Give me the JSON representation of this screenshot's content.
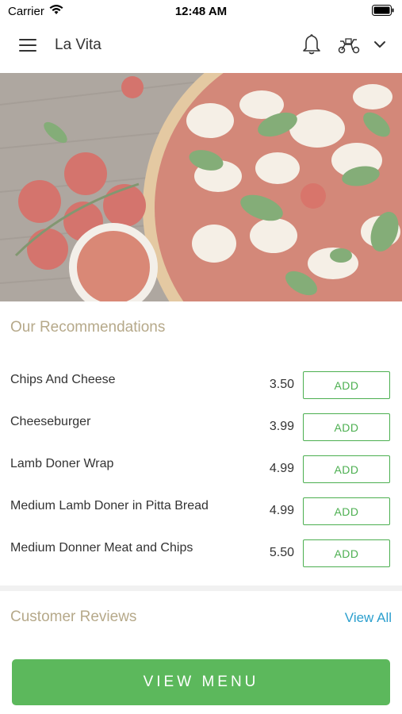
{
  "status_bar": {
    "carrier": "Carrier",
    "time": "12:48 AM"
  },
  "app_bar": {
    "title": "La Vita",
    "icons": [
      "menu-icon",
      "bell-icon",
      "scooter-icon",
      "chevron-down-icon"
    ]
  },
  "hero": {
    "image": "pizza-margherita-with-tomatoes"
  },
  "recommendations": {
    "title": "Our Recommendations",
    "items": [
      {
        "name": "Chips And Cheese",
        "price": "3.50",
        "button": "ADD"
      },
      {
        "name": "Cheeseburger",
        "price": "3.99",
        "button": "ADD"
      },
      {
        "name": "Lamb Doner Wrap",
        "price": "4.99",
        "button": "ADD"
      },
      {
        "name": "Medium Lamb Doner in Pitta Bread",
        "price": "4.99",
        "button": "ADD"
      },
      {
        "name": "Medium Donner Meat and Chips",
        "price": "5.50",
        "button": "ADD"
      }
    ]
  },
  "reviews": {
    "title": "Customer Reviews",
    "view_all": "View All"
  },
  "footer": {
    "view_menu_label": "VIEW MENU"
  },
  "colors": {
    "accent_green": "#5cb85c",
    "add_green": "#4caf50",
    "section_title": "#b6a98a",
    "link_blue": "#2b9fce"
  }
}
